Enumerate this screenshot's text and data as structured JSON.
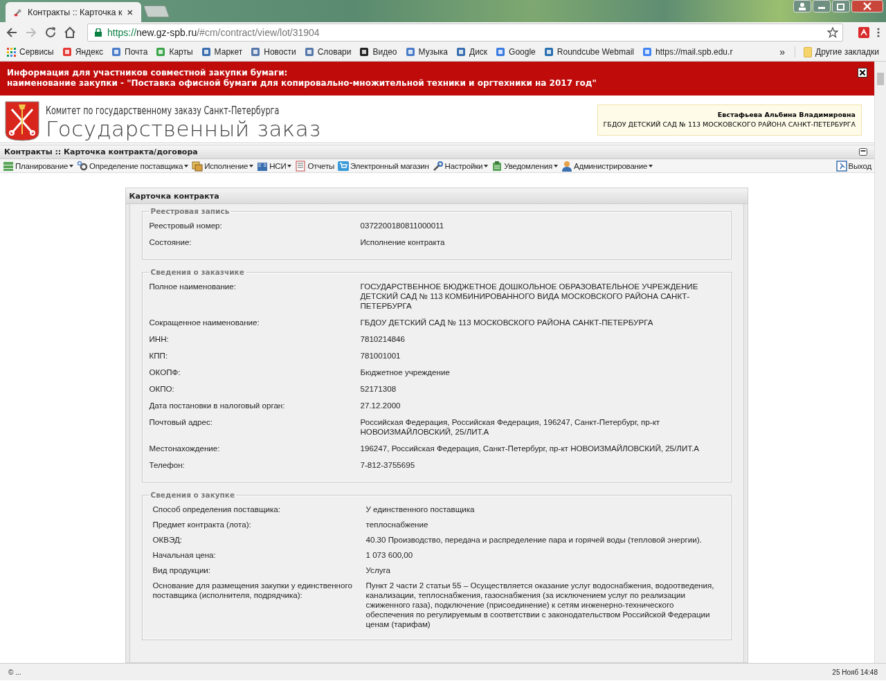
{
  "browser": {
    "tab": {
      "title": "Контракты :: Карточка к"
    },
    "address": {
      "scheme": "https://",
      "host": "new.gz-spb.ru",
      "path": "/#cm/contract/view/lot/31904"
    },
    "bookmarks": [
      {
        "label": "Сервисы"
      },
      {
        "label": "Яндекс",
        "color": "#e53935"
      },
      {
        "label": "Почта",
        "color": "#4a7cc9"
      },
      {
        "label": "Карты",
        "color": "#3aa54a"
      },
      {
        "label": "Маркет",
        "color": "#3a6fb0"
      },
      {
        "label": "Новости",
        "color": "#5577aa"
      },
      {
        "label": "Словари",
        "color": "#5577aa"
      },
      {
        "label": "Видео",
        "color": "#222222"
      },
      {
        "label": "Музыка",
        "color": "#4a7cc9"
      },
      {
        "label": "Диск",
        "color": "#3a6fb0"
      },
      {
        "label": "Google",
        "color": "#3b7be0"
      },
      {
        "label": "Roundcube Webmail",
        "color": "#2a6fb0"
      },
      {
        "label": "https://mail.spb.edu.r",
        "color": "#4285f4"
      }
    ],
    "overflow": "»",
    "other_bookmarks": "Другие закладки"
  },
  "banner": {
    "lines": [
      "Информация для участников совместной закупки бумаги:",
      "наименование закупки - \"Поставка офисной бумаги для копировально-множительной техники и оргтехники на 2017 год\""
    ]
  },
  "header": {
    "subtitle": "Комитет по государственному заказу Санкт-Петербурга",
    "title": "Государственный заказ",
    "user": {
      "name": "Евстафьева Альбина Владимировна",
      "org": "ГБДОУ ДЕТСКИЙ САД № 113 МОСКОВСКОГО РАЙОНА САНКТ-ПЕТЕРБУРГА"
    }
  },
  "page_title": "Контракты :: Карточка контракта/договора",
  "menu": [
    {
      "label": "Планирование",
      "has_menu": true
    },
    {
      "label": "Определение поставщика",
      "has_menu": true
    },
    {
      "label": "Исполнение",
      "has_menu": true
    },
    {
      "label": "НСИ",
      "has_menu": true
    },
    {
      "label": "Отчеты",
      "has_menu": false
    },
    {
      "label": "Электронный магазин",
      "has_menu": false
    },
    {
      "label": "Настройки",
      "has_menu": true
    },
    {
      "label": "Уведомления",
      "has_menu": true
    },
    {
      "label": "Администрирование",
      "has_menu": true
    }
  ],
  "logout": "Выход",
  "card": {
    "title": "Карточка контракта",
    "sections": [
      {
        "legend": "Реестровая запись",
        "rows": [
          {
            "label": "Реестровый номер:",
            "value": "0372200180811000011"
          },
          {
            "label": "Состояние:",
            "value": "Исполнение контракта"
          }
        ]
      },
      {
        "legend": "Сведения о заказчике",
        "rows": [
          {
            "label": "Полное наименование:",
            "value": "ГОСУДАРСТВЕННОЕ БЮДЖЕТНОЕ ДОШКОЛЬНОЕ ОБРАЗОВАТЕЛЬНОЕ УЧРЕЖДЕНИЕ ДЕТСКИЙ САД № 113 КОМБИНИРОВАННОГО ВИДА МОСКОВСКОГО РАЙОНА САНКТ-ПЕТЕРБУРГА"
          },
          {
            "label": "Сокращенное наименование:",
            "value": "ГБДОУ ДЕТСКИЙ САД № 113 МОСКОВСКОГО РАЙОНА САНКТ-ПЕТЕРБУРГА"
          },
          {
            "label": "ИНН:",
            "value": "7810214846"
          },
          {
            "label": "КПП:",
            "value": "781001001"
          },
          {
            "label": "ОКОПФ:",
            "value": "Бюджетное учреждение"
          },
          {
            "label": "ОКПО:",
            "value": "52171308"
          },
          {
            "label": "Дата постановки в налоговый орган:",
            "value": "27.12.2000"
          },
          {
            "label": "Почтовый адрес:",
            "value": "Российская Федерация, Российская Федерация, 196247, Санкт-Петербург, пр-кт НОВОИЗМАЙЛОВСКИЙ, 25/ЛИТ.А"
          },
          {
            "label": "Местонахождение:",
            "value": "196247, Российская Федерация, Санкт-Петербург, пр-кт НОВОИЗМАЙЛОВСКИЙ, 25/ЛИТ.А"
          },
          {
            "label": "Телефон:",
            "value": "7-812-3755695"
          }
        ]
      },
      {
        "legend": "Сведения о закупке",
        "rows": [
          {
            "label": "Способ определения поставщика:",
            "value": "У единственного поставщика"
          },
          {
            "label": "Предмет контракта (лота):",
            "value": "теплоснабжение"
          },
          {
            "label": "ОКВЭД:",
            "value": "40.30 Производство, передача и распределение пара и горячей воды (тепловой энергии)."
          },
          {
            "label": "Начальная цена:",
            "value": "1 073 600,00"
          },
          {
            "label": "Вид продукции:",
            "value": "Услуга"
          },
          {
            "label": "Основание для размещения закупки у единственного поставщика (исполнителя, подрядчика):",
            "value": "Пункт 2 части 2 статьи 55 – Осуществляется оказание услуг водоснабжения, водоотведения, канализации, теплоснабжения, газоснабжения (за исключением услуг по реализации сжиженного газа), подключение (присоединение) к сетям инженерно-технического обеспечения по регулируемым в соответствии с законодательством Российской Федерации ценам (тарифам)"
          }
        ]
      }
    ]
  },
  "status_bar": {
    "left": "© ...",
    "right": "25 Нояб 14:48"
  }
}
